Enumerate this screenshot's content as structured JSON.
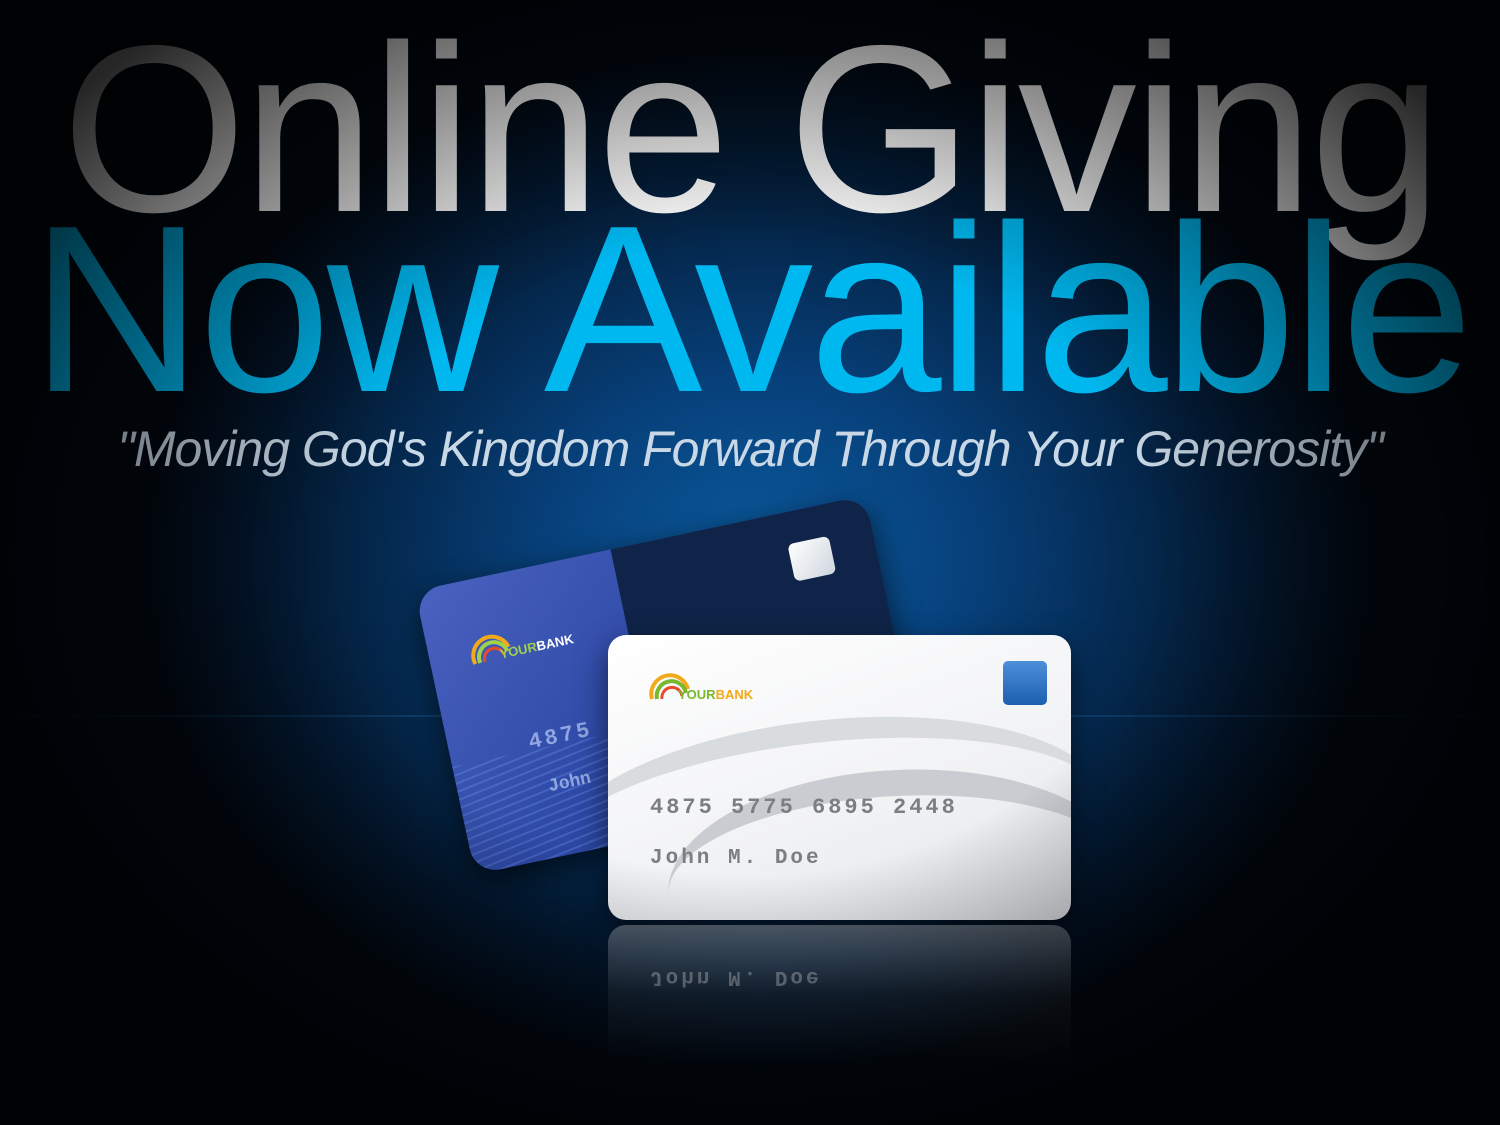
{
  "headline": {
    "line1": "Online Giving",
    "line2": "Now Available",
    "line1_color": "#ffffff",
    "line2_color": "#00b8f0"
  },
  "tagline": "\"Moving God's Kingdom Forward Through Your Generosity\"",
  "cards": {
    "back": {
      "logo_part1": "YOUR",
      "logo_part2": "BANK",
      "number_partial": "4875 5",
      "name_partial": "John",
      "color": "#2f4aa8"
    },
    "front": {
      "logo_part1": "YOUR",
      "logo_part2": "BANK",
      "number": "4875 5775 6895 2448",
      "name": "John M. Doe",
      "chip_color": "#1c5fb0"
    },
    "reflection_name": "John M. Doe"
  },
  "icons": {
    "logo": "rainbow-arc-icon",
    "chip": "card-chip-icon"
  }
}
